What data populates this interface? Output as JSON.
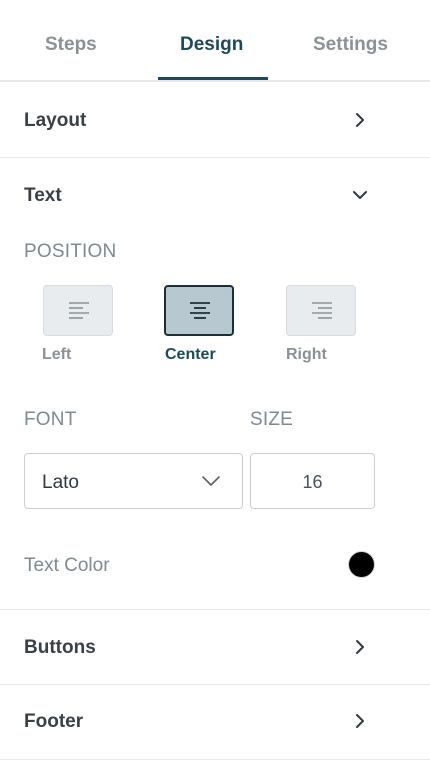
{
  "tabs": [
    {
      "label": "Steps",
      "active": false
    },
    {
      "label": "Design",
      "active": true
    },
    {
      "label": "Settings",
      "active": false
    }
  ],
  "sections": {
    "layout": {
      "title": "Layout",
      "expanded": false
    },
    "text": {
      "title": "Text",
      "expanded": true
    },
    "buttons": {
      "title": "Buttons",
      "expanded": false
    },
    "footer": {
      "title": "Footer",
      "expanded": false
    }
  },
  "text_settings": {
    "position_label": "POSITION",
    "alignments": [
      {
        "label": "Left",
        "icon": "align-left-icon",
        "selected": false
      },
      {
        "label": "Center",
        "icon": "align-center-icon",
        "selected": true
      },
      {
        "label": "Right",
        "icon": "align-right-icon",
        "selected": false
      }
    ],
    "font_label": "FONT",
    "font_value": "Lato",
    "size_label": "SIZE",
    "size_value": "16",
    "text_color_label": "Text Color",
    "text_color": "#000000"
  },
  "colors": {
    "accent": "#1c4a5a",
    "muted": "#8a9296"
  }
}
